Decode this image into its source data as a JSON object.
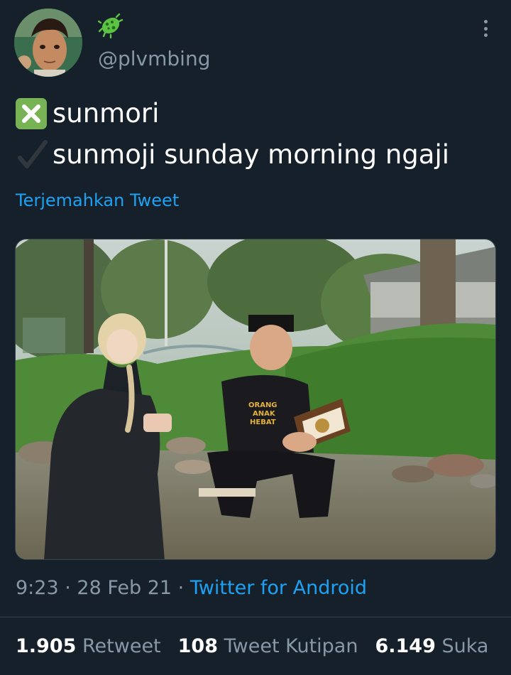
{
  "user": {
    "handle": "@plvmbing",
    "avatar_icon": "cartoon-face-avatar",
    "display_name_icon": "microbe-emoji-icon"
  },
  "tweet": {
    "line1_icon": "cross-mark-button-emoji",
    "line1_text": "sunmori",
    "line2_icon": "check-mark-emoji",
    "line2_text": "sunmoji  sunday morning ngaji",
    "translate_label": "Terjemahkan Tweet",
    "shirt_text": [
      "ORANG",
      "ANAK",
      "HEBAT"
    ]
  },
  "meta": {
    "time": "9:23",
    "separator": " · ",
    "date": "28 Feb 21",
    "source": "Twitter for Android"
  },
  "stats": {
    "retweets_count": "1.905",
    "retweets_label": "Retweet",
    "quotes_count": "108",
    "quotes_label": "Tweet Kutipan",
    "likes_count": "6.149",
    "likes_label": "Suka"
  },
  "colors": {
    "background": "#15202b",
    "link": "#1da1f2",
    "secondary_text": "#8899a6",
    "emoji_green": "#77b255"
  }
}
